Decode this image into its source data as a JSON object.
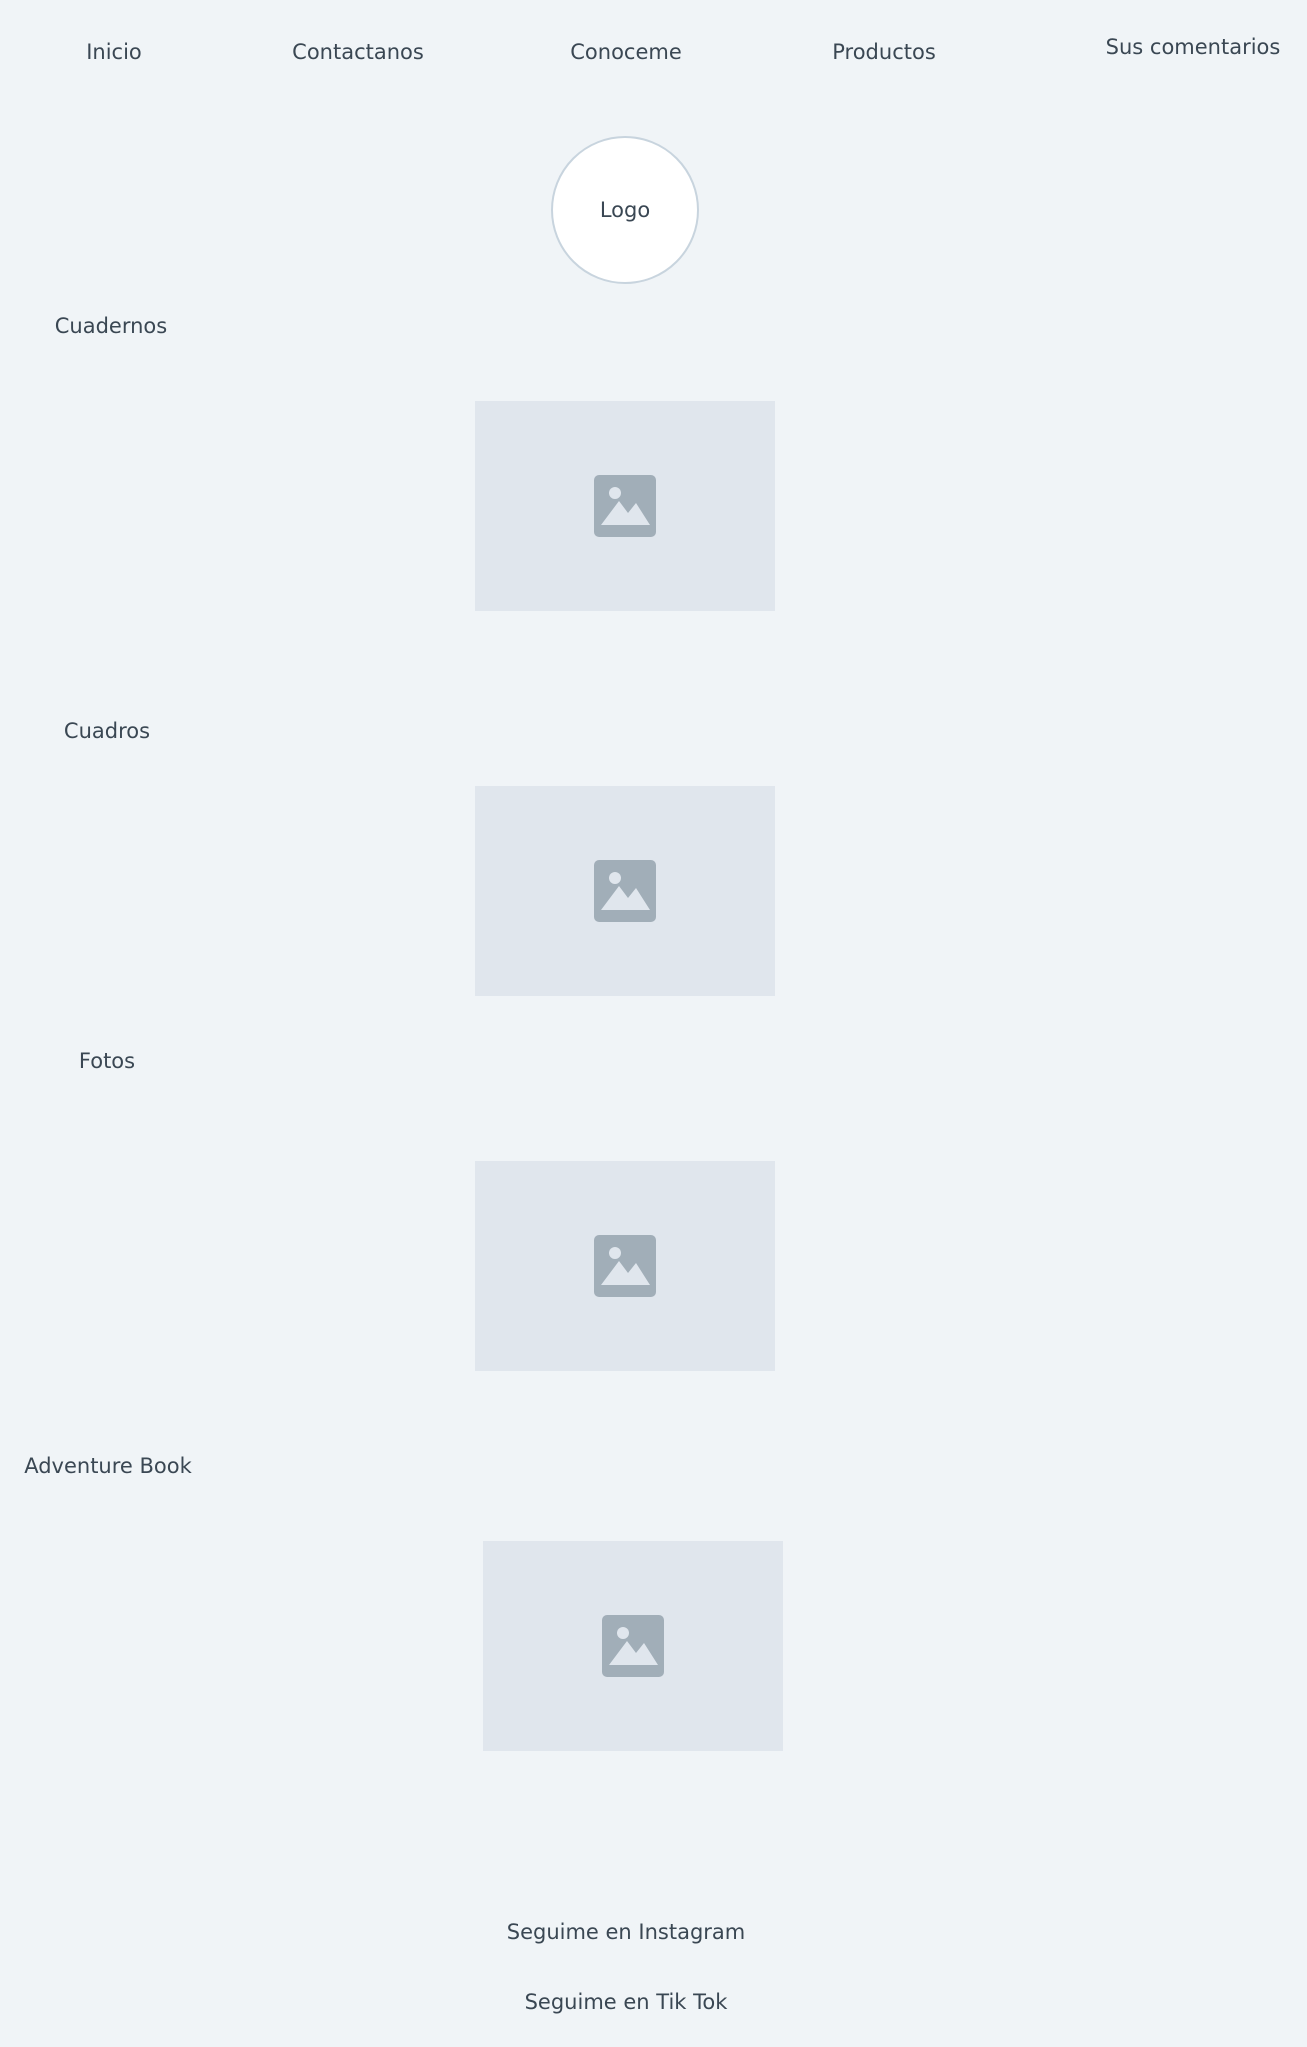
{
  "nav": {
    "items": [
      {
        "label": "Inicio"
      },
      {
        "label": "Contactanos"
      },
      {
        "label": "Conoceme"
      },
      {
        "label": "Productos"
      },
      {
        "label": "Sus comentarios"
      }
    ]
  },
  "logo": {
    "label": "Logo"
  },
  "sections": [
    {
      "title": "Cuadernos",
      "image_icon": "image-placeholder-icon"
    },
    {
      "title": "Cuadros",
      "image_icon": "image-placeholder-icon"
    },
    {
      "title": "Fotos",
      "image_icon": "image-placeholder-icon"
    },
    {
      "title": "Adventure Book",
      "image_icon": "image-placeholder-icon"
    }
  ],
  "footer": {
    "instagram_label": "Seguime en Instagram",
    "tiktok_label": "Seguime en Tik Tok"
  },
  "colors": {
    "background": "#f0f4f7",
    "text": "#3a4753",
    "placeholder_bg": "#e0e6ed",
    "placeholder_icon": "#a1aeb8",
    "logo_border": "#c8d4de"
  }
}
